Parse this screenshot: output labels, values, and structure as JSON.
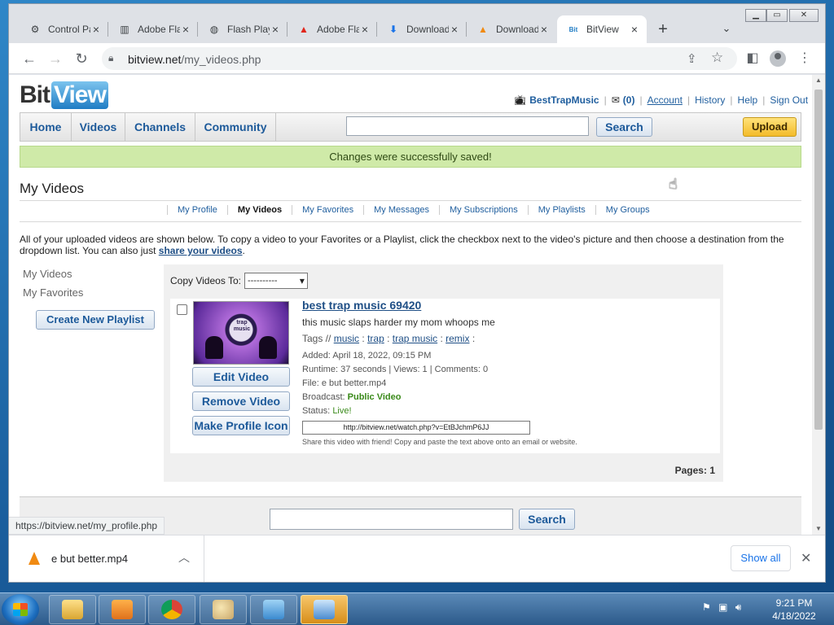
{
  "browser": {
    "tabs": [
      {
        "title": "Control Panel",
        "icon": "control-panel-icon"
      },
      {
        "title": "Adobe Flash",
        "icon": "archive-icon"
      },
      {
        "title": "Flash Player",
        "icon": "globe-icon"
      },
      {
        "title": "Adobe Flash",
        "icon": "adobe-icon"
      },
      {
        "title": "Downloads",
        "icon": "download-icon"
      },
      {
        "title": "Downloads",
        "icon": "vlc-icon"
      },
      {
        "title": "BitView",
        "icon": "bitview-icon"
      }
    ],
    "active_tab_index": 6,
    "url_host": "bitview.net",
    "url_path": "/my_videos.php",
    "status_url": "https://bitview.net/my_profile.php"
  },
  "site": {
    "logo_bit": "Bit",
    "logo_view": "View",
    "username": "BestTrapMusic",
    "inbox_count": "(0)",
    "links": [
      "Account",
      "History",
      "Help",
      "Sign Out"
    ],
    "nav": [
      "Home",
      "Videos",
      "Channels",
      "Community"
    ],
    "search_label": "Search",
    "upload_label": "Upload",
    "notice": "Changes were successfully saved!",
    "page_title": "My Videos",
    "subnav": [
      "My Profile",
      "My Videos",
      "My Favorites",
      "My Messages",
      "My Subscriptions",
      "My Playlists",
      "My Groups"
    ],
    "intro": "All of your uploaded videos are shown below. To copy a video to your Favorites or a Playlist, click the checkbox next to the video's picture and then choose a destination from the dropdown list. You can also just ",
    "intro_link": "share your videos",
    "intro_end": ".",
    "sidebar": [
      "My Videos",
      "My Favorites"
    ],
    "create_playlist": "Create New Playlist",
    "copy_videos_to": "Copy Videos To:",
    "copy_select": "----------",
    "video": {
      "title": "best trap music 69420",
      "description": "this music slaps harder my mom whoops me",
      "tags_label": "Tags //",
      "tags": [
        "music",
        "trap",
        "trap music",
        "remix"
      ],
      "added": "Added: April 18, 2022, 09:15 PM",
      "runtime": "Runtime: 37 seconds | Views: 1 | Comments: 0",
      "file": "File: e but better.mp4",
      "broadcast_label": "Broadcast:",
      "broadcast_value": "Public Video",
      "status_label": "Status:",
      "status_value": "Live!",
      "share_url": "http://bitview.net/watch.php?v=EtBJchmP6JJ",
      "share_note": "Share this video with friend! Copy and paste the text above onto an email or website.",
      "thumb_text": "trap music",
      "buttons": [
        "Edit Video",
        "Remove Video",
        "Make Profile Icon"
      ]
    },
    "pages_label": "Pages:",
    "pages_value": "1",
    "footer_search": "Search"
  },
  "downloads": {
    "file": "e but better.mp4",
    "show_all": "Show all"
  },
  "taskbar": {
    "time": "9:21 PM",
    "date": "4/18/2022"
  }
}
